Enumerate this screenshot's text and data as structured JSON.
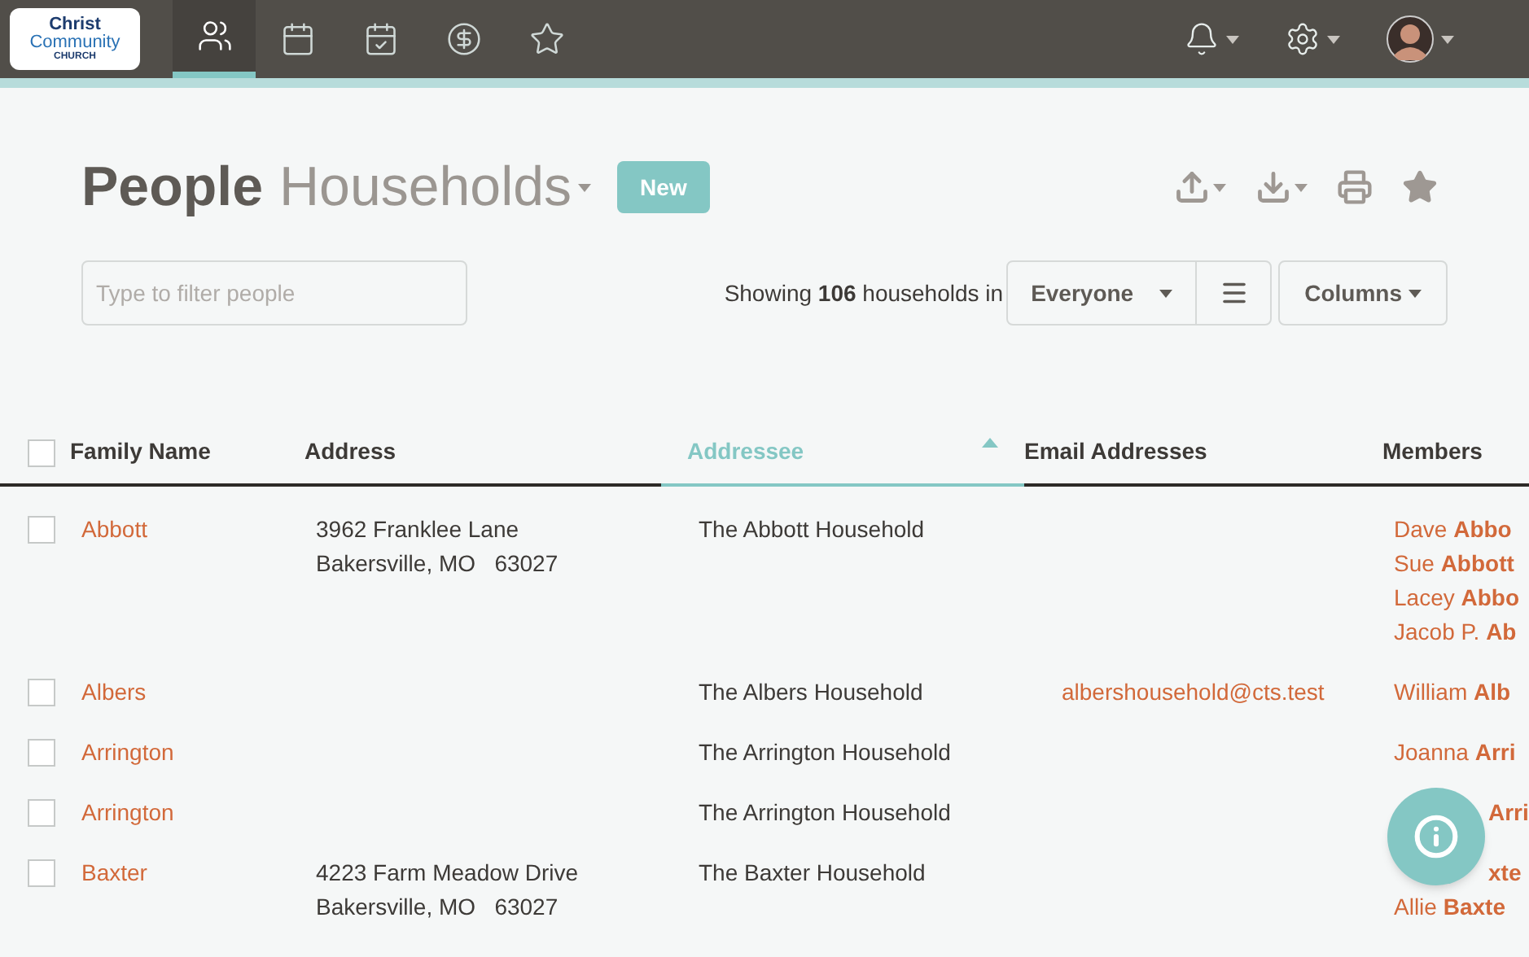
{
  "logo": {
    "line1": "Christ",
    "line2": "Community",
    "line3": "CHURCH"
  },
  "nav_tabs": [
    {
      "kind": "people",
      "selected": true
    },
    {
      "kind": "calendar",
      "selected": false
    },
    {
      "kind": "tasks",
      "selected": false
    },
    {
      "kind": "giving",
      "selected": false
    },
    {
      "kind": "star",
      "selected": false
    }
  ],
  "title": {
    "main": "People",
    "sub": "Households"
  },
  "new_button": "New",
  "filter": {
    "placeholder": "Type to filter people"
  },
  "summary": "Showing **106** households in",
  "list_select": "Everyone",
  "columns_button": "Columns",
  "table": {
    "select_all_checked": false,
    "columns": [
      {
        "label": "Family Name",
        "sorted": false
      },
      {
        "label": "Address",
        "sorted": false
      },
      {
        "label": "Addressee",
        "sorted": true
      },
      {
        "label": "Email Addresses",
        "sorted": false
      },
      {
        "label": "Members",
        "sorted": false
      }
    ],
    "rows": [
      {
        "checked": false,
        "family": "Abbott",
        "address": [
          "3962 Franklee Lane",
          "Bakersville, MO   63027"
        ],
        "addressee": "The Abbott Household",
        "members": [
          {
            "name": "Dave **Abbo**",
            "covered": false
          },
          {
            "name": "Sue **Abbott**",
            "covered": false
          },
          {
            "name": "Lacey **Abbo**",
            "covered": false
          },
          {
            "name": "Jacob P. **Ab**",
            "covered": false
          }
        ]
      },
      {
        "checked": false,
        "family": "Albers",
        "address": [],
        "addressee": "The Albers Household",
        "email": "albershousehold@cts.test",
        "members": [
          {
            "name": "William **Alb**",
            "covered": false
          }
        ]
      },
      {
        "checked": false,
        "family": "Arrington",
        "address": [],
        "addressee": "The Arrington Household",
        "members": [
          {
            "name": "Joanna **Arri**",
            "covered": false
          }
        ]
      },
      {
        "checked": false,
        "family": "Arrington",
        "address": [],
        "addressee": "The Arrington Household",
        "members": [
          {
            "name": "**Arri**",
            "covered": true
          }
        ]
      },
      {
        "checked": false,
        "family": "Baxter",
        "address": [
          "4223 Farm Meadow Drive",
          "Bakersville, MO   63027"
        ],
        "addressee": "The Baxter Household",
        "members": [
          {
            "name": "**xte**",
            "covered": true
          },
          {
            "name": "Allie **Baxte**",
            "covered": false
          }
        ]
      }
    ]
  }
}
